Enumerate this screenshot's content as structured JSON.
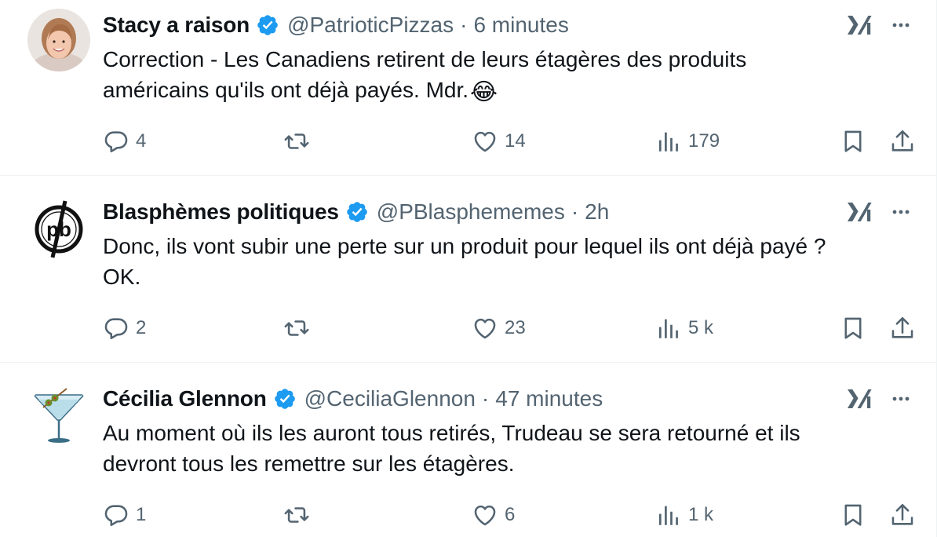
{
  "tweets": [
    {
      "author": {
        "name": "Stacy a raison",
        "handle": "@PatrioticPizzas",
        "verified": true
      },
      "separator": "·",
      "time": "6 minutes",
      "text_lines": [
        "Correction - Les Canadiens retirent de leurs étagères des produits",
        "américains qu'ils ont déjà payés. Mdr."
      ],
      "emoji": "😂",
      "stats": {
        "replies": "4",
        "reposts": "",
        "likes": "14",
        "views": "179"
      }
    },
    {
      "author": {
        "name": "Blasphèmes politiques",
        "handle": "@PBlasphememes",
        "verified": true
      },
      "separator": "·",
      "time": "2h",
      "text_lines": [
        "Donc, ils vont subir une perte sur un produit pour lequel ils ont déjà payé ?",
        "OK."
      ],
      "avatar_text": "pb",
      "stats": {
        "replies": "2",
        "reposts": "",
        "likes": "23",
        "views": "5 k"
      }
    },
    {
      "author": {
        "name": "Cécilia Glennon",
        "handle": "@CeciliaGlennon",
        "verified": true
      },
      "separator": "·",
      "time": "47 minutes",
      "text_lines": [
        "Au moment où ils les auront tous retirés, Trudeau se sera retourné et ils",
        "devront tous les remettre sur les étagères."
      ],
      "stats": {
        "replies": "1",
        "reposts": "",
        "likes": "6",
        "views": "1 k"
      }
    }
  ],
  "icons": {
    "verified": "verified-badge-icon",
    "grok": "grok-icon",
    "more": "more-icon",
    "reply": "reply-icon",
    "repost": "repost-icon",
    "like": "like-icon",
    "views": "views-icon",
    "bookmark": "bookmark-icon",
    "share": "share-icon"
  },
  "colors": {
    "text": "#0f1419",
    "secondary": "#536471",
    "verified": "#1d9bf0",
    "divider": "#eff3f4"
  }
}
